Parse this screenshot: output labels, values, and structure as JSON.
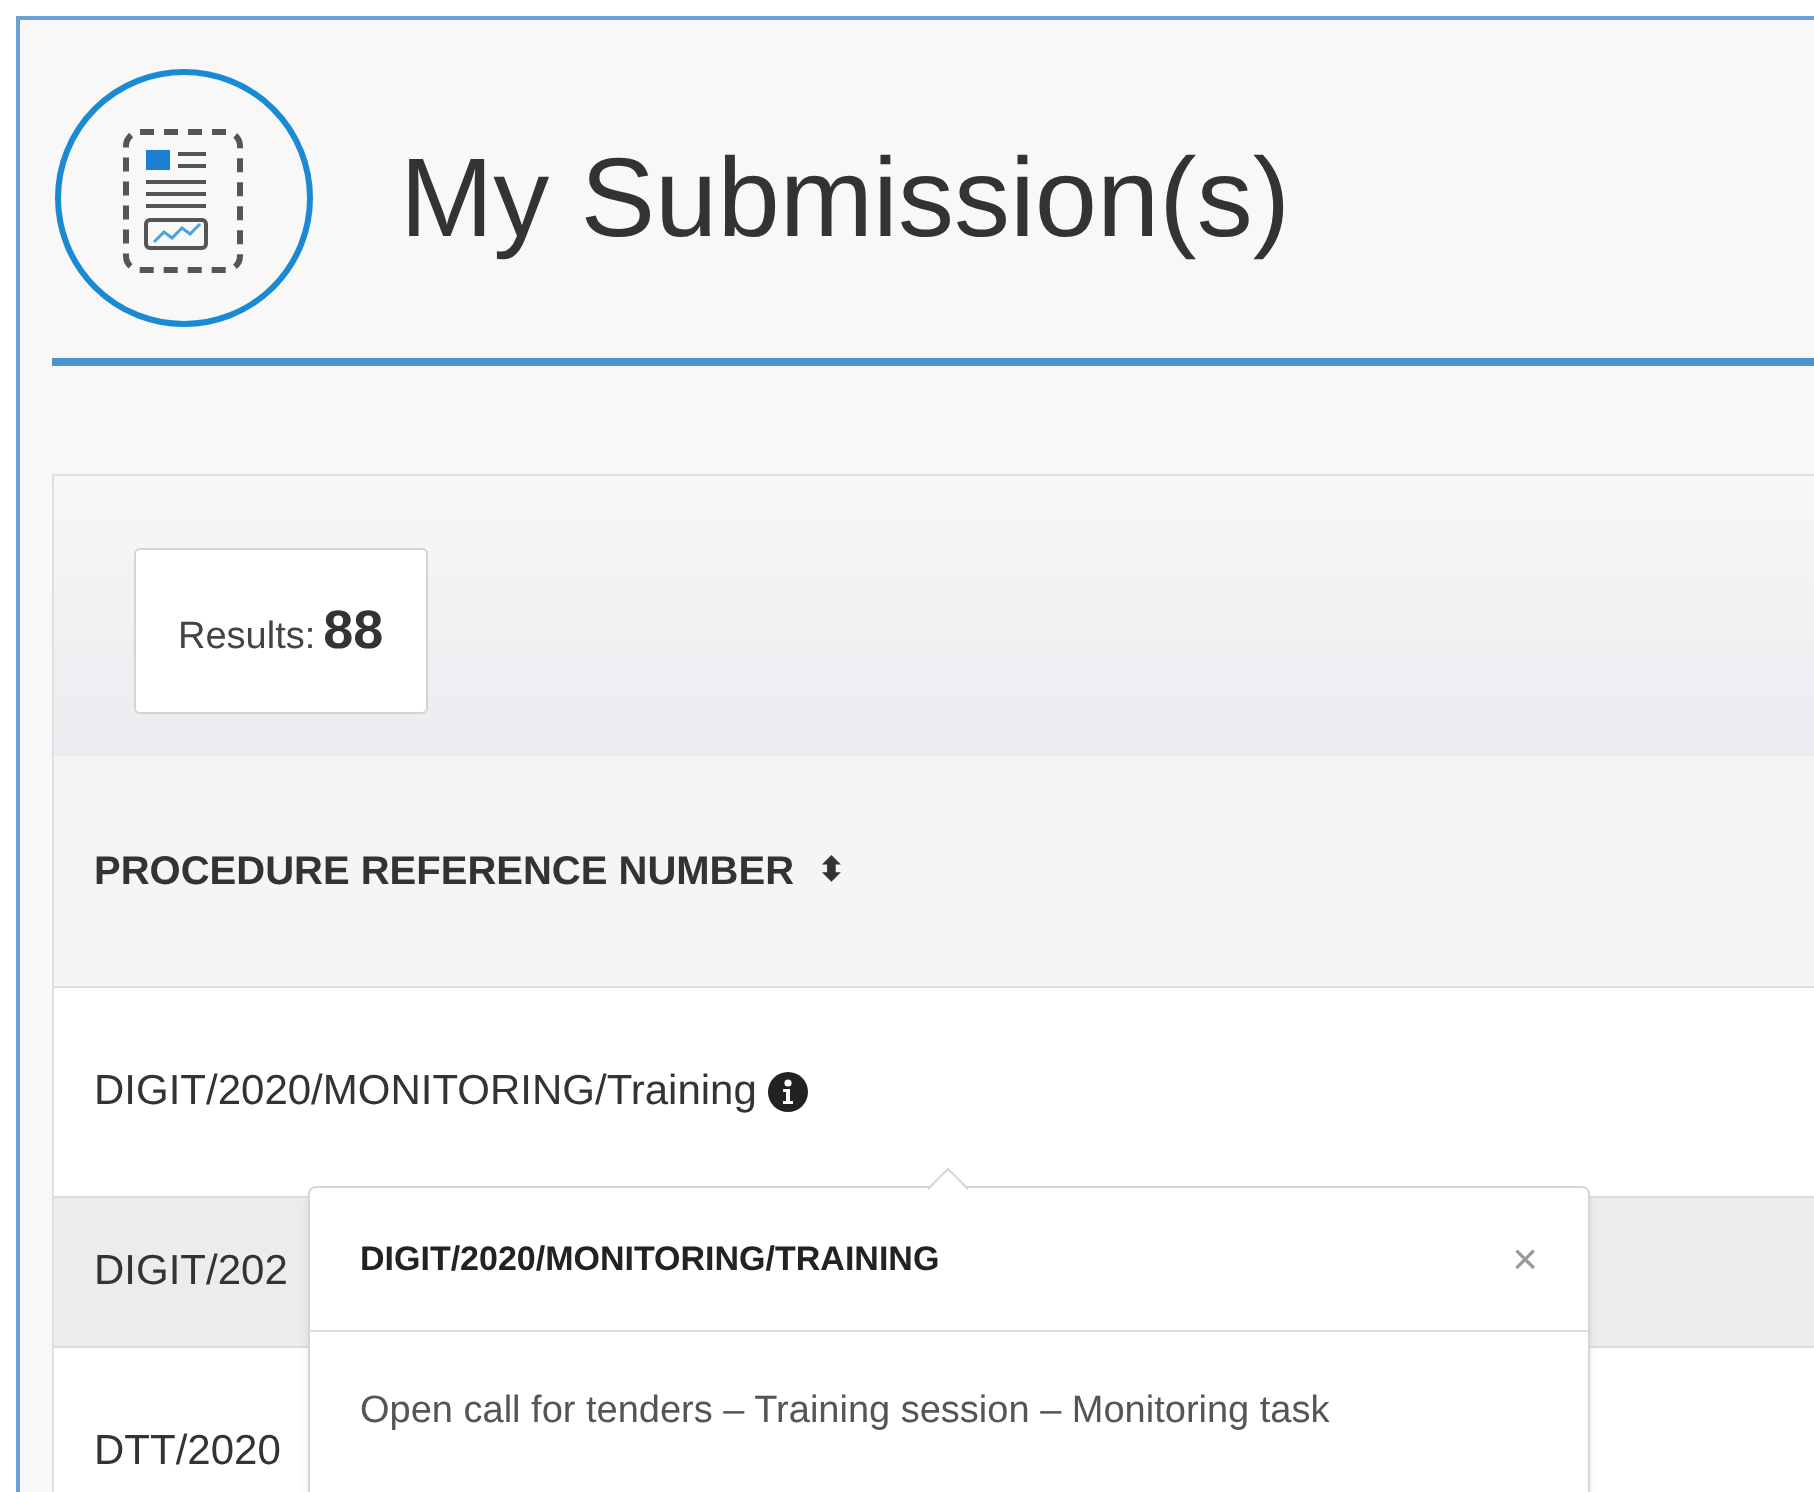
{
  "page_title": "My Submission(s)",
  "results": {
    "label": "Results:",
    "count": "88"
  },
  "table": {
    "columns": [
      {
        "label": "PROCEDURE REFERENCE NUMBER",
        "sort_icon": "⬍"
      }
    ],
    "rows": [
      {
        "reference": "DIGIT/2020/MONITORING/Training",
        "info_icon": true
      },
      {
        "reference": "DIGIT/202"
      },
      {
        "reference": "DTT/2020"
      }
    ]
  },
  "popover": {
    "title": "DIGIT/2020/MONITORING/TRAINING",
    "close": "×",
    "body": "Open call for tenders – Training session – Monitoring task"
  }
}
